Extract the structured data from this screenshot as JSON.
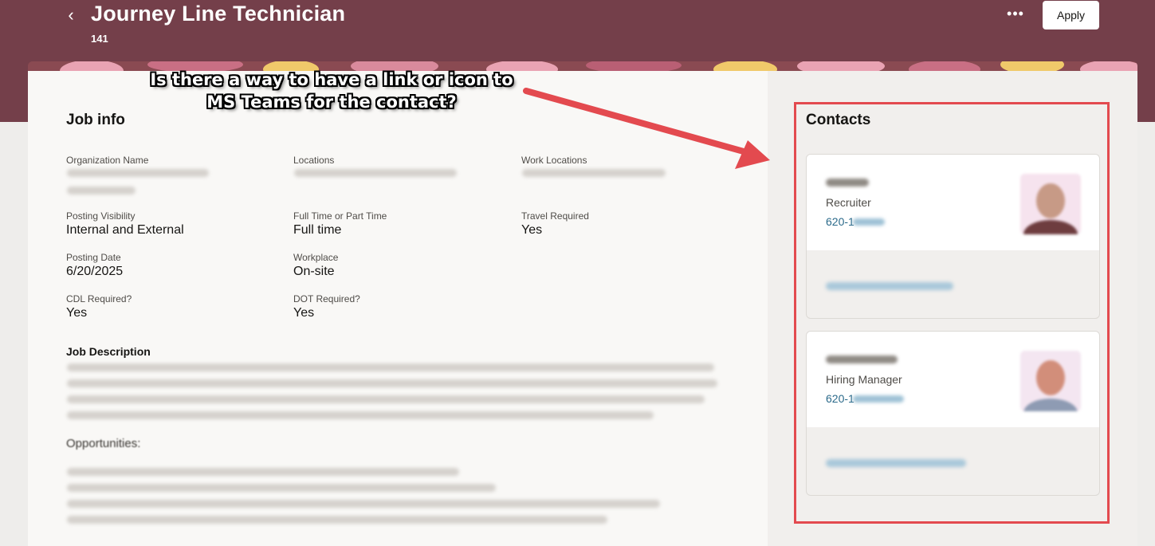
{
  "header": {
    "back_icon": "chevron-left-icon",
    "title": "Journey Line Technician",
    "subtitle": "141",
    "more_icon": "more-horizontal-icon",
    "apply_label": "Apply",
    "bg_color": "#743f4a"
  },
  "job_info": {
    "title": "Job info",
    "fields": [
      {
        "label": "Organization Name",
        "value": ""
      },
      {
        "label": "Locations",
        "value": ""
      },
      {
        "label": "Work Locations",
        "value": ""
      },
      {
        "label": "Posting Visibility",
        "value": "Internal and External"
      },
      {
        "label": "Full Time or Part Time",
        "value": "Full time"
      },
      {
        "label": "Travel Required",
        "value": "Yes"
      },
      {
        "label": "Posting Date",
        "value": "6/20/2025"
      },
      {
        "label": "Workplace",
        "value": "On-site"
      },
      {
        "label": "CDL Required?",
        "value": "Yes"
      },
      {
        "label": "DOT Required?",
        "value": "Yes"
      }
    ],
    "description_heading": "Job Description",
    "opportunities_heading": "Opportunities:"
  },
  "contacts": {
    "title": "Contacts",
    "items": [
      {
        "role": "Recruiter",
        "phone": "620-1"
      },
      {
        "role": "Hiring Manager",
        "phone": "620-1"
      }
    ]
  },
  "annotation": {
    "text_line1": "Is there a way to have a link or icon to",
    "text_line2": "MS Teams for the contact?",
    "color": "#e34a4f"
  }
}
